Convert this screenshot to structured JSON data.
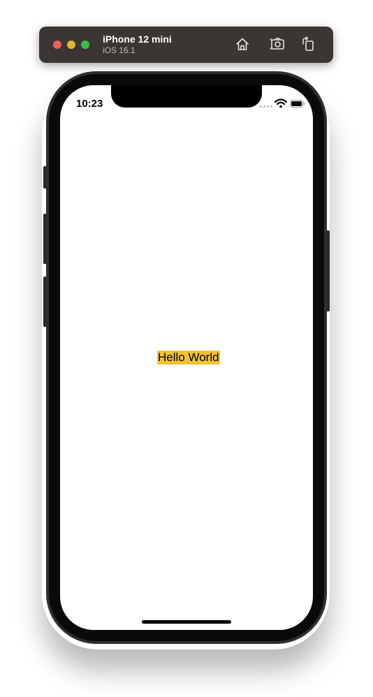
{
  "simulator": {
    "device_name": "iPhone 12 mini",
    "os_version": "iOS 16.1",
    "traffic_lights": {
      "close_color": "#ec5f57",
      "minimize_color": "#e0b631",
      "maximize_color": "#37c245"
    },
    "toolbar_buttons": [
      "home-icon",
      "screenshot-icon",
      "rotate-icon"
    ]
  },
  "status_bar": {
    "time": "10:23",
    "icons": [
      "signal-icon",
      "wifi-icon",
      "battery-icon"
    ]
  },
  "content": {
    "label": "Hello World",
    "label_background": "#f2c231"
  }
}
